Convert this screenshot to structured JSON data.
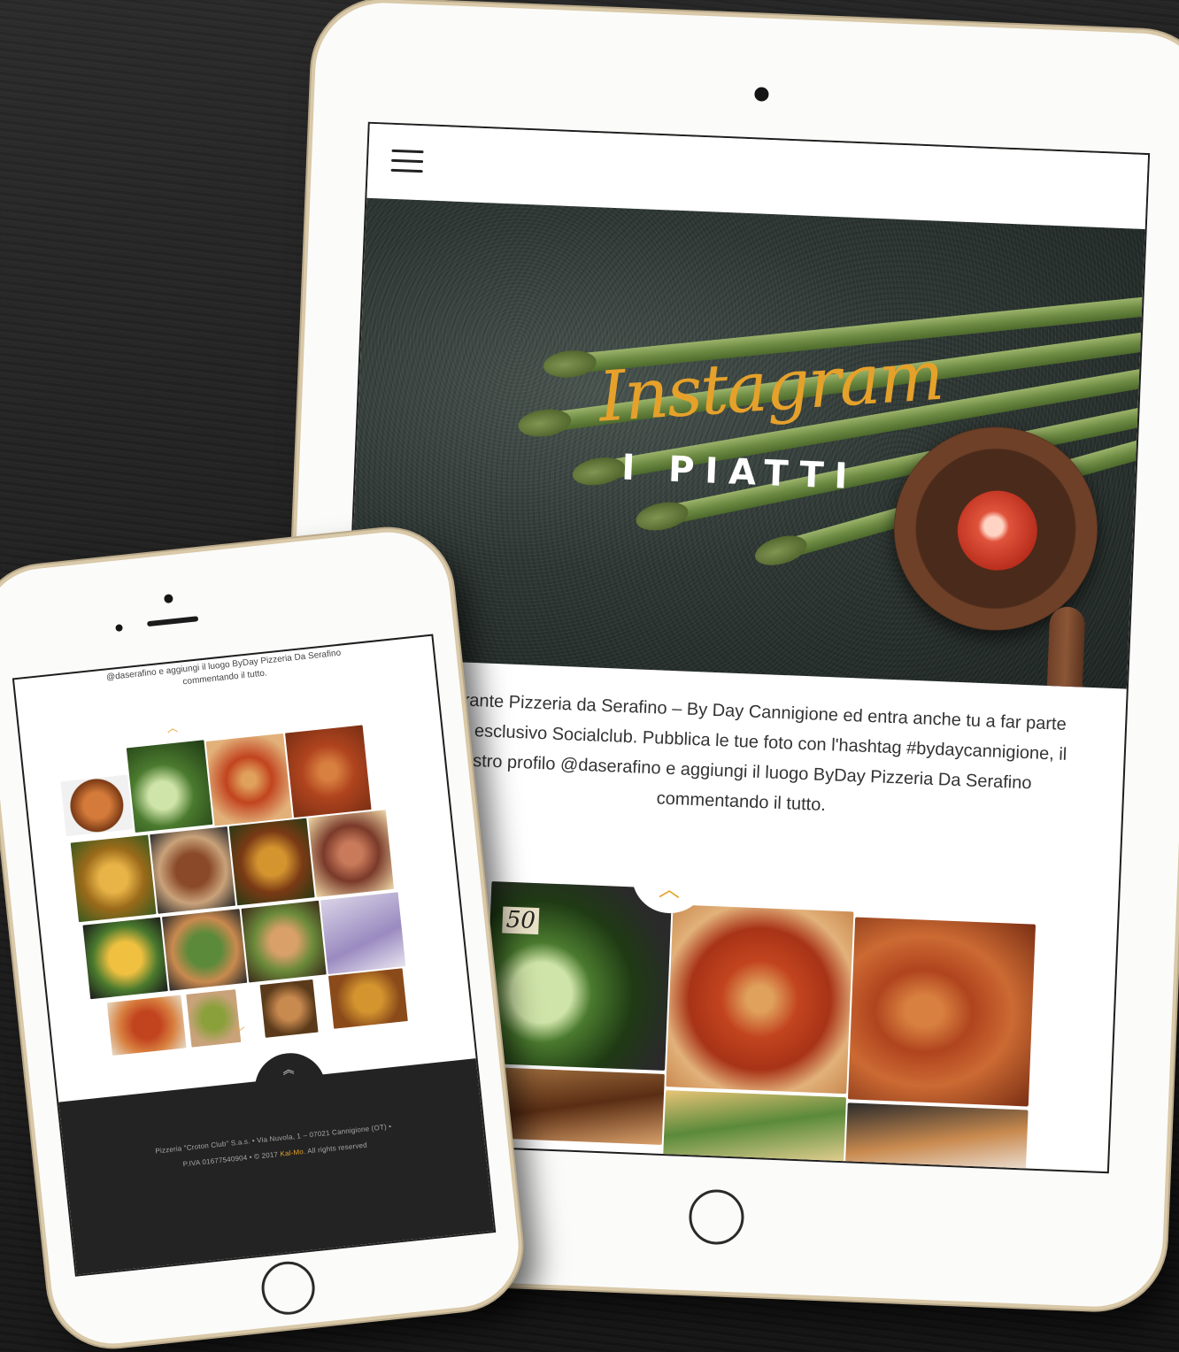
{
  "tablet": {
    "hero": {
      "script_title": "Instagram",
      "title": "I PIATTI"
    },
    "intro_text": "Ristorante Pizzeria da Serafino – By Day Cannigione ed entra anche tu a far parte nostro esclusivo Socialclub. Pubblica le tue foto con l'hashtag #bydaycannigione, il nostro profilo @daserafino e aggiungi il luogo ByDay Pizzeria Da Serafino commentando il tutto.",
    "gallery": {
      "photo_captions": [
        "50"
      ],
      "scroll_up_icon": "chevron-up-icon"
    },
    "menu_icon": "hamburger-menu-icon"
  },
  "phone": {
    "intro_line_1": "@daserafino e aggiungi il luogo ByDay Pizzeria Da Serafino",
    "intro_line_2": "commentando il tutto.",
    "footer": {
      "line_1": "Pizzeria \"Croton Club\" S.a.s. • Via Nuvola, 1 – 07021 Cannigione (OT) •",
      "line_2_prefix": "P.IVA 01677540904 • © 2017",
      "line_2_brand": "Kal-Mo",
      "line_2_suffix": ". All rights reserved",
      "back_to_top_icon": "double-chevron-up-icon"
    }
  },
  "colors": {
    "accent": "#e6a12b",
    "footer_bg": "#232323",
    "background": "#1b1b1b"
  }
}
